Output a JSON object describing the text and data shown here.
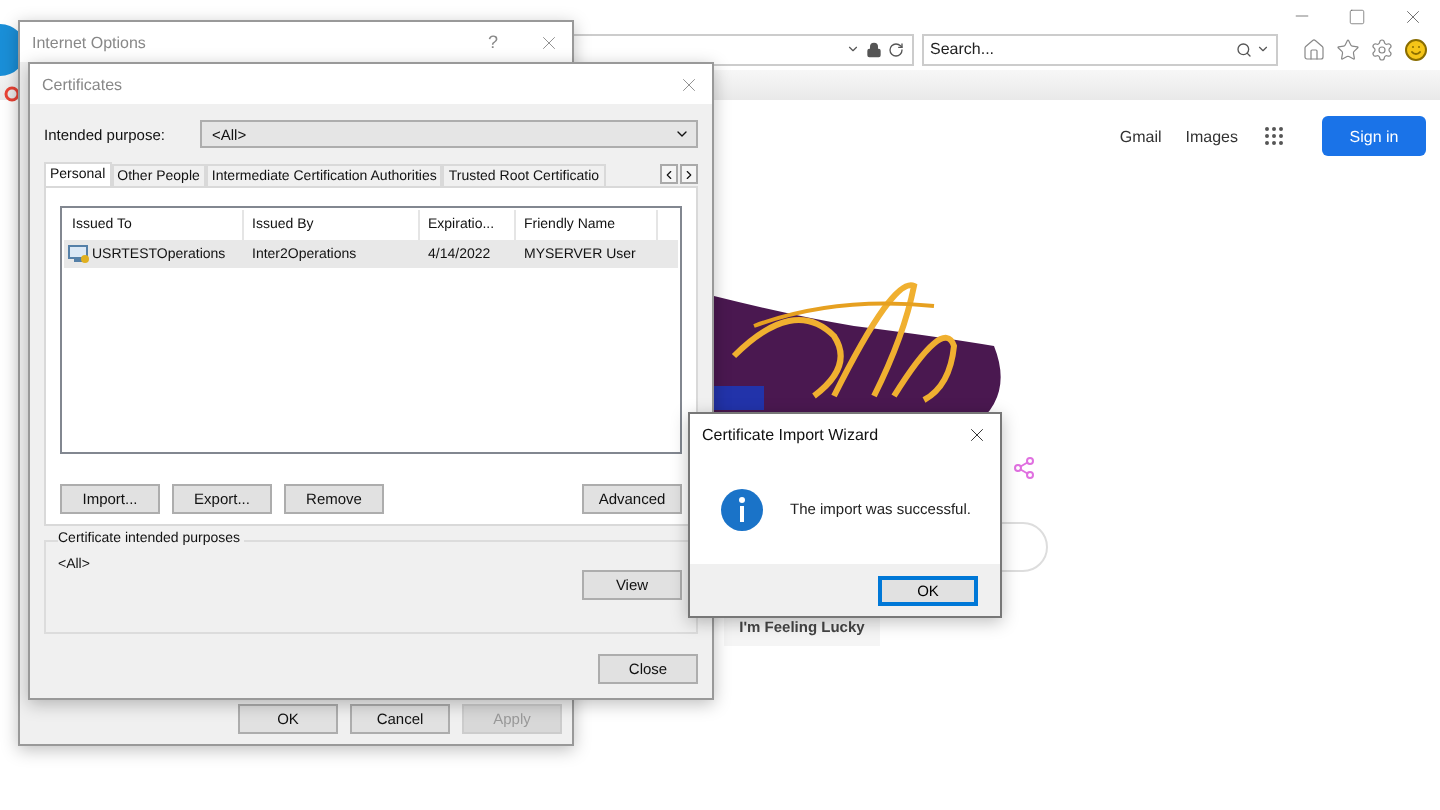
{
  "browser": {
    "search_field": {
      "placeholder": "Search..."
    },
    "page": {
      "links": [
        "Gmail",
        "Images"
      ],
      "sign_in": "Sign in",
      "lucky_button": "I'm Feeling Lucky"
    }
  },
  "internet_options": {
    "title": "Internet Options",
    "help": "?",
    "buttons": [
      {
        "label": "OK",
        "disabled": false
      },
      {
        "label": "Cancel",
        "disabled": false
      },
      {
        "label": "Apply",
        "disabled": true
      }
    ]
  },
  "certificates": {
    "title": "Certificates",
    "purpose_label": "Intended purpose:",
    "purpose_value": "<All>",
    "tabs": [
      {
        "label": "Personal",
        "selected": true
      },
      {
        "label": "Other People",
        "selected": false
      },
      {
        "label": "Intermediate Certification Authorities",
        "selected": false
      },
      {
        "label": "Trusted Root Certificatio",
        "selected": false
      }
    ],
    "columns": [
      "Issued To",
      "Issued By",
      "Expiratio...",
      "Friendly Name"
    ],
    "rows": [
      {
        "cells": [
          "USRTESTOperations",
          "Inter2Operations",
          "4/14/2022",
          "MYSERVER User"
        ],
        "selected": true
      }
    ],
    "buttons": [
      "Import...",
      "Export...",
      "Remove",
      "Advanced"
    ],
    "purposes_group": {
      "title": "Certificate intended purposes",
      "value": "<All>",
      "button": "View"
    },
    "close_button": "Close"
  },
  "wizard": {
    "title": "Certificate Import Wizard",
    "message": "The import was successful.",
    "button": "OK"
  }
}
